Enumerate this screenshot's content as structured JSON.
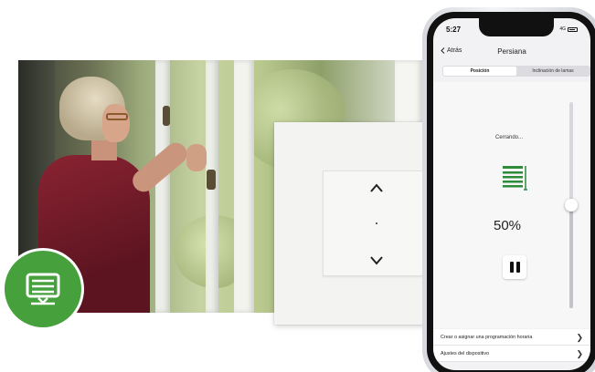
{
  "phone": {
    "status_time": "5:27",
    "network": "4G",
    "back_label": "Atrás",
    "title": "Persiana",
    "tabs": [
      {
        "label": "Posición",
        "active": true
      },
      {
        "label": "Inclinación de lamas",
        "active": false
      }
    ],
    "status_text": "Cerrando...",
    "percent_label": "50%",
    "position_fraction": 0.5,
    "menu": [
      {
        "label": "Crear o asignar una programación horaria"
      },
      {
        "label": "Ajustes del dispositivo"
      }
    ]
  },
  "colors": {
    "accent_green": "#46a13c",
    "icon_green": "#2e8b3a"
  },
  "icons": {
    "badge": "roller-blind-icon",
    "status": "roller-blind-icon",
    "switch_up": "chevron-up-icon",
    "switch_down": "chevron-down-icon",
    "pause": "pause-icon"
  }
}
